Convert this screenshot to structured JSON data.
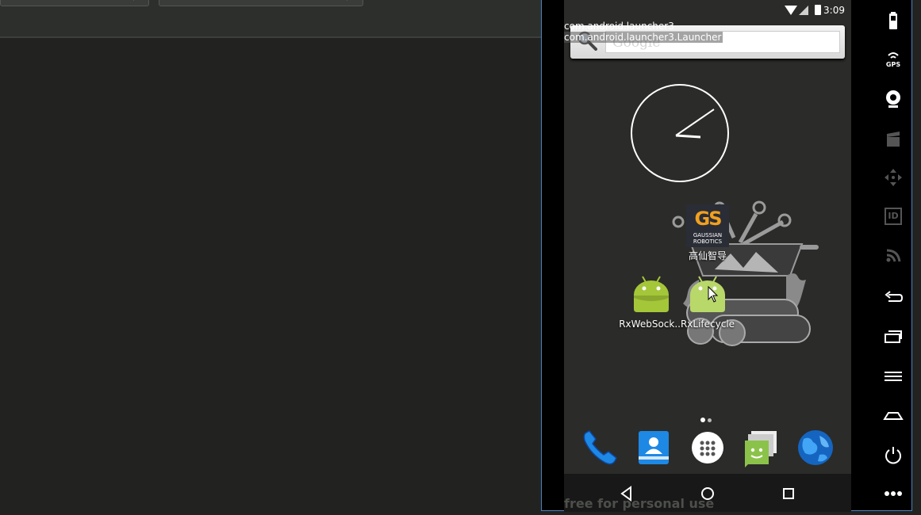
{
  "device": {
    "status_time": "3:09",
    "debug_lines": [
      "com.android.launcher3",
      "com.android.launcher3.Launcher"
    ],
    "search": {
      "logo_text": "Google"
    },
    "apps": [
      {
        "label": "高仙智导",
        "logo_letters": "GS",
        "logo_sub": "GAUSSIAN ROBOTICS"
      },
      {
        "label": "RxWebSock..."
      },
      {
        "label": "RxLifecycle"
      }
    ],
    "dock": [
      "phone-icon",
      "contacts-icon",
      "app-drawer-icon",
      "messaging-icon",
      "browser-icon"
    ],
    "watermark": "free for personal use"
  },
  "toolbar": {
    "items": [
      "battery-icon",
      "gps-icon",
      "camera-icon",
      "media-icon",
      "dpad-icon",
      "id-icon",
      "network-icon",
      "back-icon",
      "recents-icon",
      "menu-icon",
      "home-icon",
      "power-icon",
      "more-icon"
    ],
    "gps_label": "GPS",
    "id_label": "ID"
  },
  "colors": {
    "android_green": "#a4c639",
    "frame_border": "#4a7fc0",
    "screen_bg": "#2b2b29",
    "ide_bg": "#222320"
  }
}
